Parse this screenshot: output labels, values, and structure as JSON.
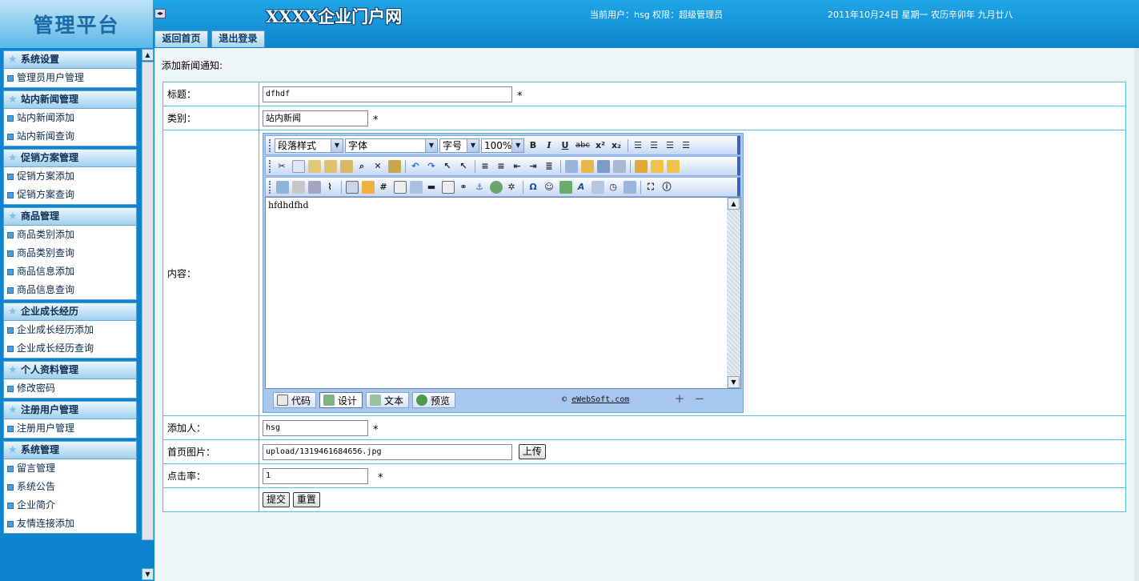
{
  "header": {
    "logo_text": "管理平台",
    "site_title": "XXXX企业门户网",
    "user_info": "当前用户：hsg 权限：超级管理员",
    "date_info": "2011年10月24日 星期一 农历辛卯年 九月廿八",
    "collapse_glyph": "◂▸",
    "buttons": {
      "home": "返回首页",
      "logout": "退出登录"
    }
  },
  "sidebar": {
    "groups": [
      {
        "title": "系统设置",
        "items": [
          "管理员用户管理"
        ]
      },
      {
        "title": "站内新闻管理",
        "items": [
          "站内新闻添加",
          "站内新闻查询"
        ]
      },
      {
        "title": "促销方案管理",
        "items": [
          "促销方案添加",
          "促销方案查询"
        ]
      },
      {
        "title": "商品管理",
        "items": [
          "商品类别添加",
          "商品类别查询",
          "商品信息添加",
          "商品信息查询"
        ]
      },
      {
        "title": "企业成长经历",
        "items": [
          "企业成长经历添加",
          "企业成长经历查询"
        ]
      },
      {
        "title": "个人资料管理",
        "items": [
          "修改密码"
        ]
      },
      {
        "title": "注册用户管理",
        "items": [
          "注册用户管理"
        ]
      },
      {
        "title": "系统管理",
        "items": [
          "留言管理",
          "系统公告",
          "企业简介",
          "友情连接添加"
        ]
      }
    ]
  },
  "form": {
    "heading": "添加新闻通知:",
    "required_mark": "*",
    "title_label": "标题：",
    "title_value": "dfhdf",
    "category_label": "类别：",
    "category_value": "站内新闻",
    "content_label": "内容：",
    "author_label": "添加人：",
    "author_value": "hsg",
    "image_label": "首页图片：",
    "image_value": "upload/1319461684656.jpg",
    "upload_button": "上传",
    "clicks_label": "点击率：",
    "clicks_value": "1",
    "submit_button": "提交",
    "reset_button": "重置"
  },
  "editor": {
    "para_style": "段落样式",
    "font": "字体",
    "font_size": "字号",
    "zoom": "100%",
    "content": "hfdhdfhd",
    "format_buttons": [
      "B",
      "I",
      "U",
      "abc",
      "x²",
      "x₂"
    ],
    "modes": [
      "代码",
      "设计",
      "文本",
      "预览"
    ],
    "active_mode": "设计",
    "copyright_symbol": "©",
    "copyright_link": "eWebSoft.com",
    "zoom_in": "+",
    "zoom_out": "−"
  }
}
